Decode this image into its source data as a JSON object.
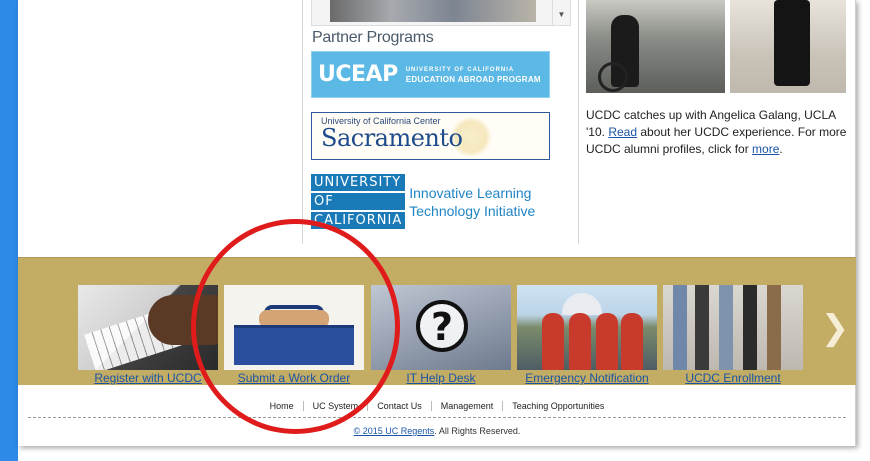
{
  "partners": {
    "title": "Partner Programs",
    "ucea": {
      "big": "UCEAP",
      "line1": "UNIVERSITY OF CALIFORNIA",
      "line2": "EDUCATION ABROAD PROGRAM"
    },
    "sacramento": {
      "small": "University of California Center",
      "big": "Sacramento"
    },
    "ilti": {
      "uc_lines": [
        "UNIVERSITY",
        "OF",
        "CALIFORNIA"
      ],
      "line1": "Innovative Learning",
      "line2": "Technology Initiative"
    }
  },
  "caption": {
    "text1": "UCDC catches up with Angelica Galang, UCLA '10.",
    "read_link": "Read",
    "text2": "about her UCDC experience. For more UCDC alumni profiles, click for",
    "more_link": "more",
    "text3": "."
  },
  "tiles": [
    {
      "label": "Register with UCDC"
    },
    {
      "label": "Submit a Work Order"
    },
    {
      "label": "IT Help Desk"
    },
    {
      "label": "Emergency Notification"
    },
    {
      "label": "UCDC Enrollment"
    }
  ],
  "carousel": {
    "next_glyph": "❯",
    "icon": "chevron-right-icon"
  },
  "footer": {
    "nav": [
      "Home",
      "UC System",
      "Contact Us",
      "Management",
      "Teaching Opportunities"
    ],
    "copyright_link": "© 2015 UC Regents",
    "copyright_text": ". All Rights Reserved."
  },
  "colors": {
    "accent_blue": "#2e8ae6",
    "gold_band": "#c3ac63",
    "link": "#1a55a5",
    "annotation_red": "#e01b1b"
  }
}
